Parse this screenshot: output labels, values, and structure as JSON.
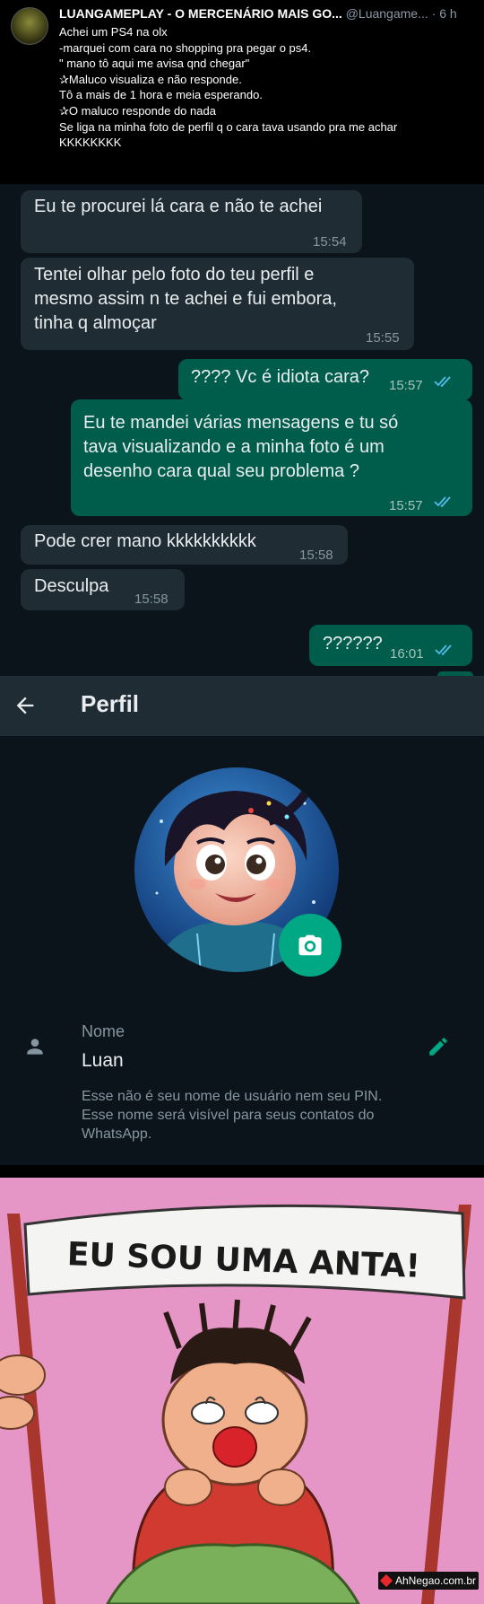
{
  "tweet": {
    "display_name": "LUANGAMEPLAY - O MERCENÁRIO MAIS GO...",
    "handle": "@Luangame...",
    "separator": "·",
    "age": "6 h",
    "lines": [
      "Achei um PS4 na olx",
      "-marquei com cara no shopping pra pegar o ps4.",
      "\" mano tô aqui me avisa qnd chegar\"",
      "✰Maluco visualiza e não responde.",
      "Tô a mais de 1 hora e meia esperando.",
      "✰O maluco responde do nada",
      "Se liga na minha foto de perfil q o cara tava usando pra me achar",
      "KKKKKKKK"
    ]
  },
  "chat": {
    "messages": [
      {
        "direction": "in",
        "lines": [
          "Eu te procurei lá cara e não te achei"
        ],
        "time": "15:54"
      },
      {
        "direction": "in",
        "lines": [
          "Tentei olhar pelo foto do teu perfil e",
          "mesmo assim n te achei e fui embora,",
          "tinha q almoçar"
        ],
        "time": "15:55"
      },
      {
        "direction": "out",
        "lines": [
          "???? Vc é idiota cara?"
        ],
        "time": "15:57",
        "read": true
      },
      {
        "direction": "out",
        "lines": [
          "Eu te mandei várias mensagens e tu só",
          "tava visualizando  e a minha foto é um",
          "desenho cara qual seu problema ?"
        ],
        "time": "15:57",
        "read": true
      },
      {
        "direction": "in",
        "lines": [
          "Pode crer mano kkkkkkkkkk"
        ],
        "time": "15:58"
      },
      {
        "direction": "in",
        "lines": [
          "Desculpa"
        ],
        "time": "15:58"
      },
      {
        "direction": "out",
        "lines": [
          "??????"
        ],
        "time": "16:01",
        "read": true
      }
    ]
  },
  "profile": {
    "title": "Perfil",
    "name_label": "Nome",
    "name_value": "Luan",
    "name_note": [
      "Esse não é seu nome de usuário nem seu PIN.",
      "Esse nome será visível para seus contatos do",
      "WhatsApp."
    ]
  },
  "meme": {
    "banner_text": "EU SOU UMA ANTA!"
  },
  "watermark": "AhNegao.com.br",
  "colors": {
    "whatsapp_accent": "#00a884",
    "bubble_out": "#005c4b",
    "bubble_in": "#1f2c33",
    "read_ticks": "#53bdeb",
    "chat_background": "#0b141a",
    "comic_background": "#e596c7"
  },
  "icons": [
    "back-arrow-icon",
    "camera-icon",
    "person-icon",
    "pencil-icon",
    "double-check-icon"
  ]
}
